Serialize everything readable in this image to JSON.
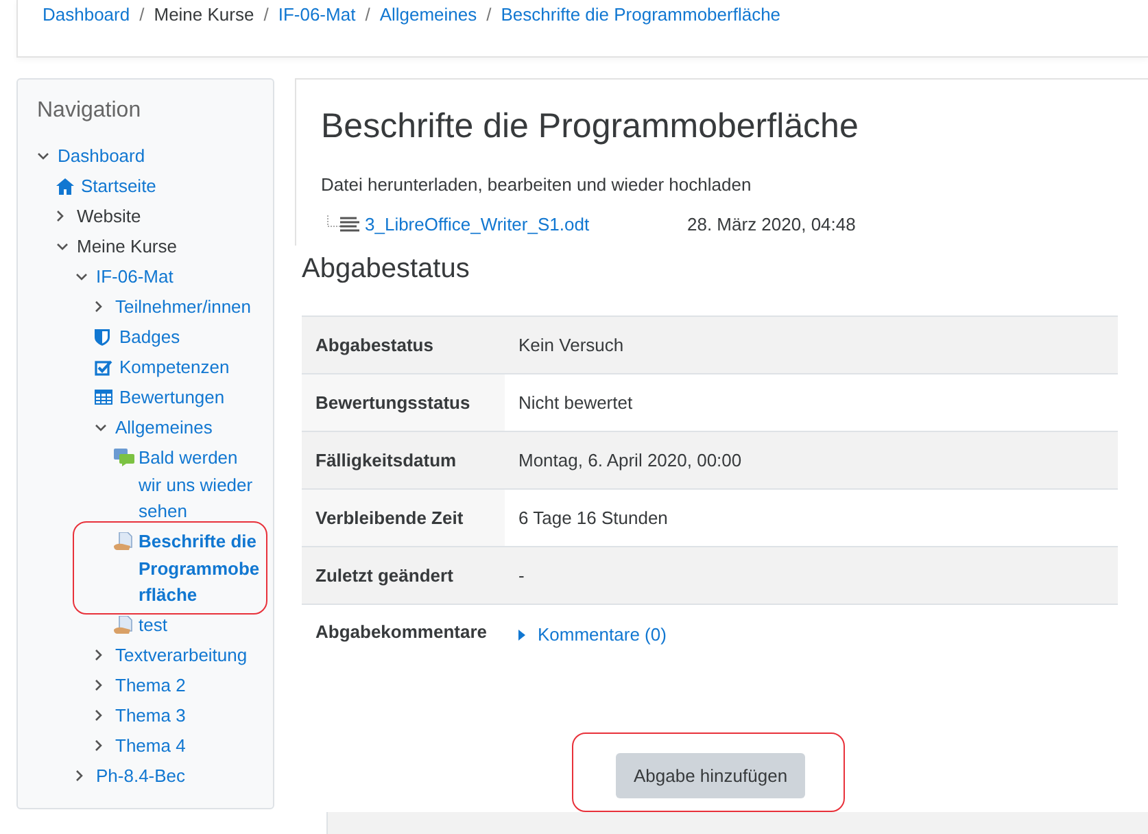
{
  "breadcrumb": {
    "separator": "/",
    "items": [
      {
        "label": "Dashboard",
        "link": true
      },
      {
        "label": "Meine Kurse",
        "link": false
      },
      {
        "label": "IF-06-Mat",
        "link": true
      },
      {
        "label": "Allgemeines",
        "link": true
      },
      {
        "label": "Beschrifte die Programmoberfläche",
        "link": true
      }
    ]
  },
  "navigation": {
    "title": "Navigation",
    "items": [
      {
        "label": "Dashboard",
        "kind": "branch",
        "expanded": true,
        "link": true,
        "children": [
          {
            "label": "Startseite",
            "kind": "home",
            "link": true
          },
          {
            "label": "Website",
            "kind": "branch",
            "expanded": false,
            "link": false
          },
          {
            "label": "Meine Kurse",
            "kind": "branch",
            "expanded": true,
            "link": false,
            "children": [
              {
                "label": "IF-06-Mat",
                "kind": "branch",
                "expanded": true,
                "link": true,
                "children": [
                  {
                    "label": "Teilnehmer/innen",
                    "kind": "branch",
                    "expanded": false,
                    "link": true
                  },
                  {
                    "label": "Badges",
                    "kind": "badge",
                    "link": true
                  },
                  {
                    "label": "Kompetenzen",
                    "kind": "competency",
                    "link": true
                  },
                  {
                    "label": "Bewertungen",
                    "kind": "grades",
                    "link": true
                  },
                  {
                    "label": "Allgemeines",
                    "kind": "branch",
                    "expanded": true,
                    "link": true,
                    "children": [
                      {
                        "label": "Bald werden wir uns wieder sehen",
                        "kind": "forum",
                        "link": true
                      },
                      {
                        "label": "Beschrifte die Programmoberfläche",
                        "kind": "assignment",
                        "link": true,
                        "current": true,
                        "highlighted": true
                      },
                      {
                        "label": "test",
                        "kind": "assignment",
                        "link": true
                      }
                    ]
                  },
                  {
                    "label": "Textverarbeitung",
                    "kind": "branch",
                    "expanded": false,
                    "link": true
                  },
                  {
                    "label": "Thema 2",
                    "kind": "branch",
                    "expanded": false,
                    "link": true
                  },
                  {
                    "label": "Thema 3",
                    "kind": "branch",
                    "expanded": false,
                    "link": true
                  },
                  {
                    "label": "Thema 4",
                    "kind": "branch",
                    "expanded": false,
                    "link": true
                  }
                ]
              },
              {
                "label": "Ph-8.4-Bec",
                "kind": "branch",
                "expanded": false,
                "link": true
              }
            ]
          }
        ]
      }
    ]
  },
  "page": {
    "title": "Beschrifte die Programmoberfläche",
    "intro": "Datei herunterladen, bearbeiten und wieder hochladen",
    "file": {
      "name": "3_LibreOffice_Writer_S1.odt",
      "date": "28. März 2020, 04:48"
    }
  },
  "status": {
    "heading": "Abgabestatus",
    "rows": [
      {
        "label": "Abgabestatus",
        "value": "Kein Versuch"
      },
      {
        "label": "Bewertungsstatus",
        "value": "Nicht bewertet"
      },
      {
        "label": "Fälligkeitsdatum",
        "value": "Montag, 6. April 2020, 00:00"
      },
      {
        "label": "Verbleibende Zeit",
        "value": "6 Tage 16 Stunden"
      },
      {
        "label": "Zuletzt geändert",
        "value": "-"
      },
      {
        "label": "Abgabekommentare",
        "comments": "Kommentare (0)"
      }
    ]
  },
  "submit": {
    "label": "Abgabe hinzufügen",
    "highlighted": true
  }
}
